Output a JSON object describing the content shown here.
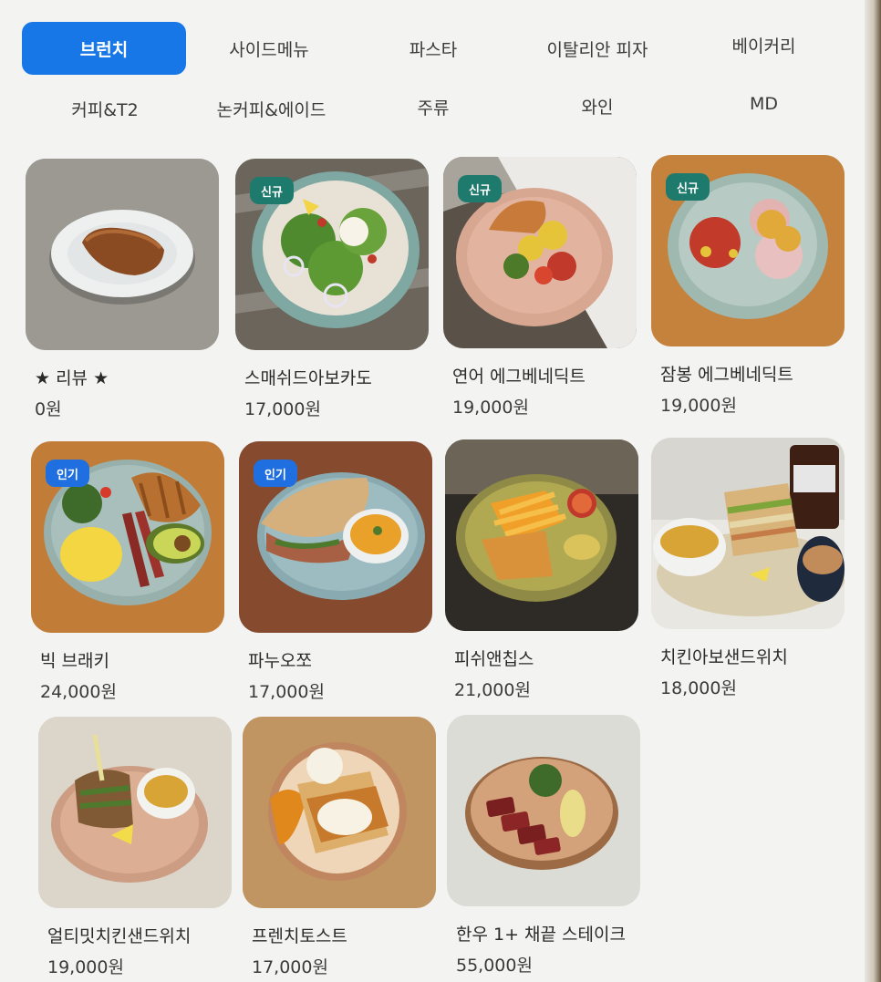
{
  "tabs": [
    {
      "label": "브런치",
      "active": true
    },
    {
      "label": "사이드메뉴",
      "active": false
    },
    {
      "label": "파스타",
      "active": false
    },
    {
      "label": "이탈리안 피자",
      "active": false
    },
    {
      "label": "베이커리",
      "active": false
    },
    {
      "label": "커피&T2",
      "active": false
    },
    {
      "label": "논커피&에이드",
      "active": false
    },
    {
      "label": "주류",
      "active": false
    },
    {
      "label": "와인",
      "active": false
    },
    {
      "label": "MD",
      "active": false
    }
  ],
  "items": [
    {
      "name": "★ 리뷰 ★",
      "price": "0원",
      "badge": "",
      "photo": "pound-cake"
    },
    {
      "name": "스매쉬드아보카도",
      "price": "17,000원",
      "badge": "신규",
      "photo": "avocado-salad"
    },
    {
      "name": "연어 에그베네딕트",
      "price": "19,000원",
      "badge": "신규",
      "photo": "salmon-benedict"
    },
    {
      "name": "잠봉 에그베네딕트",
      "price": "19,000원",
      "badge": "신규",
      "photo": "jambon-benedict"
    },
    {
      "name": "빅 브래키",
      "price": "24,000원",
      "badge": "인기",
      "photo": "big-breakfast"
    },
    {
      "name": "파누오쪼",
      "price": "17,000원",
      "badge": "인기",
      "photo": "panuozzo"
    },
    {
      "name": "피쉬앤칩스",
      "price": "21,000원",
      "badge": "",
      "photo": "fish-and-chips"
    },
    {
      "name": "치킨아보샌드위치",
      "price": "18,000원",
      "badge": "",
      "photo": "chicken-avo-sandwich"
    },
    {
      "name": "얼티밋치킨샌드위치",
      "price": "19,000원",
      "badge": "",
      "photo": "ultimate-chicken-sandwich"
    },
    {
      "name": "프렌치토스트",
      "price": "17,000원",
      "badge": "",
      "photo": "french-toast"
    },
    {
      "name": "한우 1+ 채끝 스테이크",
      "price": "55,000원",
      "badge": "",
      "photo": "hanwoo-steak"
    }
  ],
  "colors": {
    "accent": "#1877e6",
    "badge_new": "#1e7a6c",
    "badge_hot": "#1f6fe0"
  }
}
